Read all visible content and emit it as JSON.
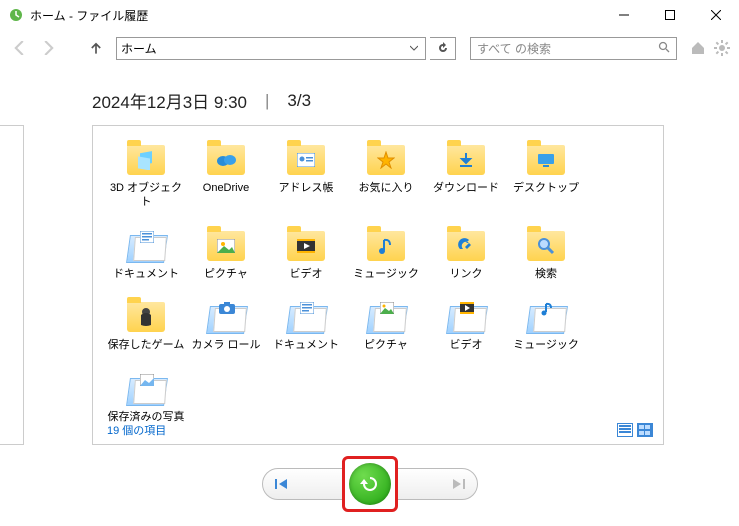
{
  "window": {
    "title": "ホーム - ファイル履歴"
  },
  "toolbar": {
    "address": "ホーム",
    "search_placeholder": "すべて の検索"
  },
  "header": {
    "timestamp": "2024年12月3日 9:30",
    "page": "3/3"
  },
  "items": [
    {
      "label": "3D オブジェクト",
      "icon": "folder-3d"
    },
    {
      "label": "OneDrive",
      "icon": "folder-cloud"
    },
    {
      "label": "アドレス帳",
      "icon": "folder-contact"
    },
    {
      "label": "お気に入り",
      "icon": "folder-star"
    },
    {
      "label": "ダウンロード",
      "icon": "folder-download"
    },
    {
      "label": "デスクトップ",
      "icon": "folder-desktop"
    },
    {
      "label": "ドキュメント",
      "icon": "library-doc"
    },
    {
      "label": "ピクチャ",
      "icon": "folder-picture"
    },
    {
      "label": "ビデオ",
      "icon": "folder-video"
    },
    {
      "label": "ミュージック",
      "icon": "folder-music"
    },
    {
      "label": "リンク",
      "icon": "folder-link"
    },
    {
      "label": "検索",
      "icon": "folder-search"
    },
    {
      "label": "保存したゲーム",
      "icon": "folder-game"
    },
    {
      "label": "カメラ ロール",
      "icon": "library-camera"
    },
    {
      "label": "ドキュメント",
      "icon": "library-doc"
    },
    {
      "label": "ピクチャ",
      "icon": "library-picture"
    },
    {
      "label": "ビデオ",
      "icon": "library-video"
    },
    {
      "label": "ミュージック",
      "icon": "library-music"
    },
    {
      "label": "保存済みの写真",
      "icon": "library-saved"
    }
  ],
  "footer": {
    "count_label": "19 個の項目"
  }
}
